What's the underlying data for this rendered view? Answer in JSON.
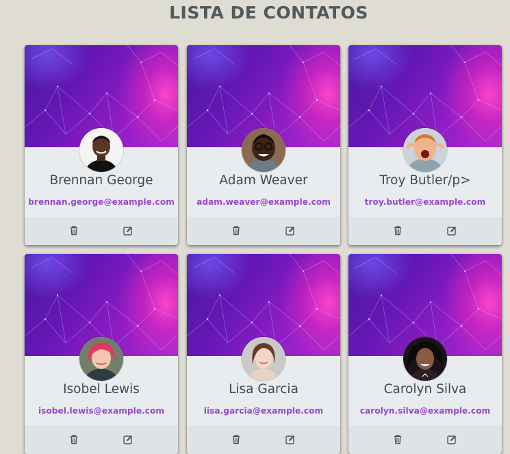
{
  "header": {
    "title": "LISTA DE CONTATOS"
  },
  "icons": {
    "delete": "trash-icon",
    "edit": "edit-icon"
  },
  "colors": {
    "email": "#9746d2",
    "cover_start": "#4a1aa0",
    "cover_end": "#e42fc0"
  },
  "contacts": [
    {
      "name": "Brennan George",
      "email": "brennan.george@example.com"
    },
    {
      "name": "Adam Weaver",
      "email": "adam.weaver@example.com"
    },
    {
      "name": "Troy Butler/p>",
      "email": "troy.butler@example.com"
    },
    {
      "name": "Isobel Lewis",
      "email": "isobel.lewis@example.com"
    },
    {
      "name": "Lisa Garcia",
      "email": "lisa.garcia@example.com"
    },
    {
      "name": "Carolyn Silva",
      "email": "carolyn.silva@example.com"
    }
  ]
}
